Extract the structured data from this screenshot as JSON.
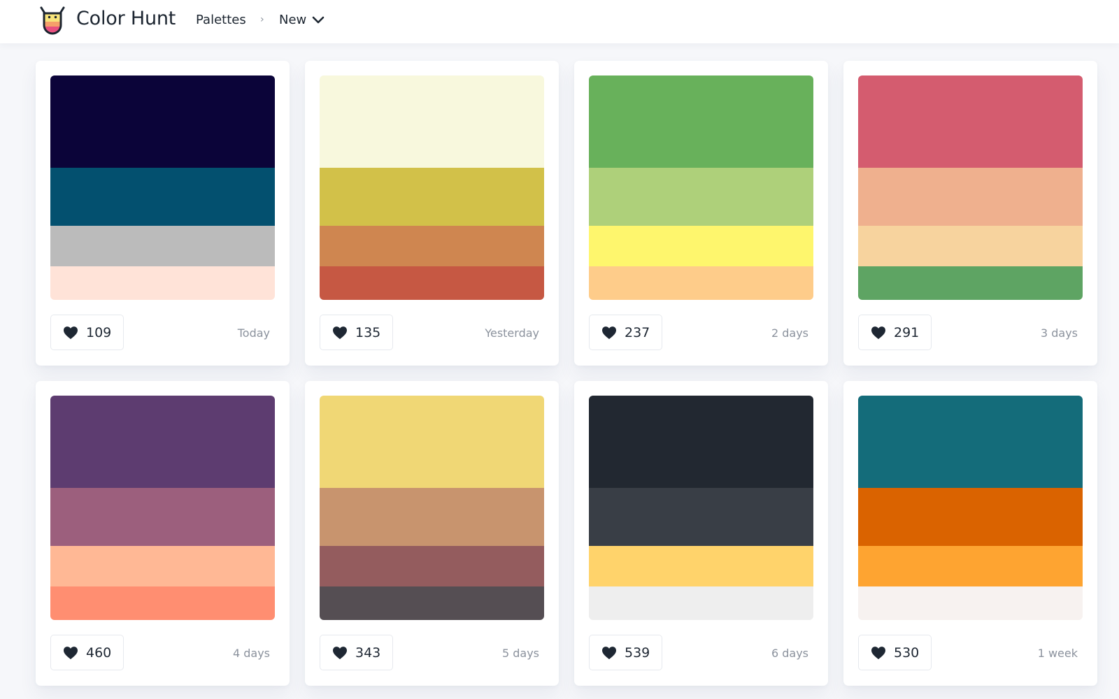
{
  "header": {
    "brand": "Color Hunt",
    "nav_link": "Palettes",
    "separator": "›",
    "dropdown_label": "New",
    "icons": {
      "logo": "color-hunt-cup-logo",
      "separator": "chevron-right-icon",
      "dropdown": "chevron-down-icon"
    }
  },
  "palettes": [
    {
      "likes": "109",
      "date": "Today",
      "colors": [
        "#0b0439",
        "#03506f",
        "#bbbbbb",
        "#ffe3d8"
      ]
    },
    {
      "likes": "135",
      "date": "Yesterday",
      "colors": [
        "#f8f8dd",
        "#d2c149",
        "#cf8650",
        "#c65843"
      ]
    },
    {
      "likes": "237",
      "date": "2 days",
      "colors": [
        "#68b15b",
        "#aed07a",
        "#fef66d",
        "#fecc8a"
      ]
    },
    {
      "likes": "291",
      "date": "3 days",
      "colors": [
        "#d45c6f",
        "#efb08e",
        "#f7d39e",
        "#5ea463"
      ]
    },
    {
      "likes": "460",
      "date": "4 days",
      "colors": [
        "#5d3c70",
        "#9c5f7d",
        "#ffb895",
        "#ff8e71"
      ]
    },
    {
      "likes": "343",
      "date": "5 days",
      "colors": [
        "#f0d775",
        "#c8946e",
        "#945c5e",
        "#554e53"
      ]
    },
    {
      "likes": "539",
      "date": "6 days",
      "colors": [
        "#222831",
        "#393e46",
        "#ffd36b",
        "#eeeeee"
      ]
    },
    {
      "likes": "530",
      "date": "1 week",
      "colors": [
        "#146c7a",
        "#da6300",
        "#fea431",
        "#f7f2f0"
      ]
    }
  ],
  "like_icon": "heart-icon",
  "colors": {
    "page_background": "#f6f7fa",
    "text": "#1e2733",
    "muted_text": "#8b929d"
  }
}
